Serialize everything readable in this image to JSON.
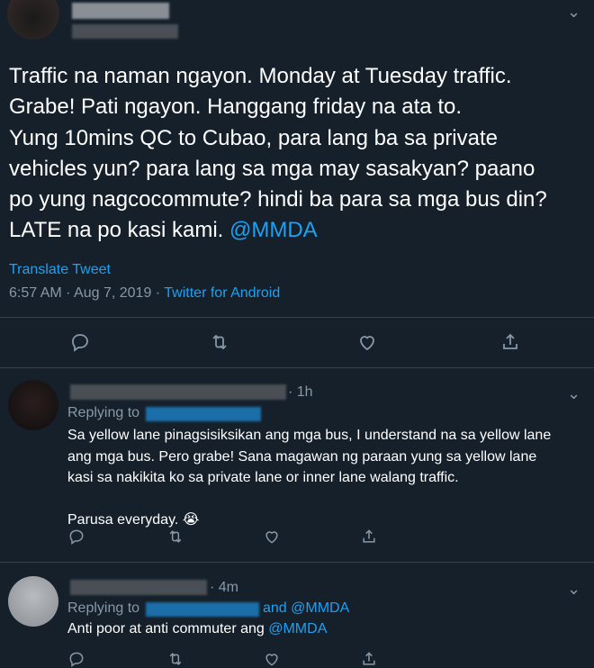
{
  "main_tweet": {
    "text": "Traffic na naman ngayon. Monday at Tuesday traffic.\nGrabe! Pati ngayon. Hanggang friday na ata to.\nYung 10mins QC to Cubao, para lang ba sa private\nvehicles yun? para lang sa mga may sasakyan? paano\npo yung nagcocommute? hindi ba para sa mga bus din?\nLATE na po kasi kami. ",
    "mention": "@MMDA",
    "translate": "Translate Tweet",
    "time": "6:57 AM",
    "dot1": " · ",
    "date": "Aug 7, 2019",
    "dot2": " · ",
    "source": "Twitter for Android"
  },
  "reply1": {
    "age": "· 1h",
    "replying_to": "Replying to",
    "text": "Sa yellow lane pinagsisiksikan ang mga bus, I understand na sa yellow lane\nang mga bus. Pero grabe! Sana magawan ng paraan yung sa yellow lane\nkasi sa nakikita ko sa private lane or inner lane walang traffic.\n\nParusa everyday. ",
    "emoji": "😭"
  },
  "reply2": {
    "age": "· 4m",
    "replying_to": "Replying to",
    "and_mention": "and @MMDA",
    "text_prefix": "Anti poor at anti commuter ang ",
    "mention": "@MMDA"
  },
  "icons": {
    "reply": "reply-icon",
    "retweet": "retweet-icon",
    "like": "heart-icon",
    "share": "share-icon",
    "menu": "chevron-down-icon"
  },
  "colors": {
    "background": "#15202b",
    "link": "#1da1f2",
    "muted": "#8899a6",
    "divider": "#38444d"
  }
}
